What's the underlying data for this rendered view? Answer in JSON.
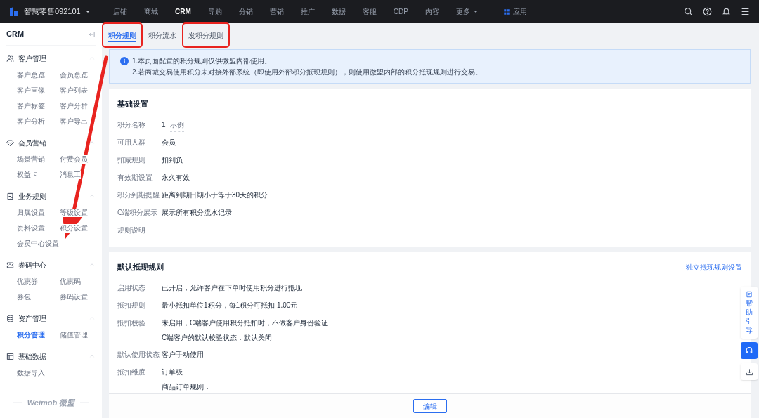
{
  "topbar": {
    "brand": "智慧零售092101",
    "nav": [
      {
        "label": "店铺",
        "selected": false,
        "kind": "link"
      },
      {
        "label": "商城",
        "selected": false,
        "kind": "link"
      },
      {
        "label": "CRM",
        "selected": true,
        "kind": "link"
      },
      {
        "label": "导购",
        "selected": false,
        "kind": "link"
      },
      {
        "label": "分销",
        "selected": false,
        "kind": "link"
      },
      {
        "label": "营销",
        "selected": false,
        "kind": "link"
      },
      {
        "label": "推广",
        "selected": false,
        "kind": "link"
      },
      {
        "label": "数据",
        "selected": false,
        "kind": "link"
      },
      {
        "label": "客服",
        "selected": false,
        "kind": "link"
      },
      {
        "label": "CDP",
        "selected": false,
        "kind": "link"
      },
      {
        "label": "内容",
        "selected": false,
        "kind": "link"
      },
      {
        "label": "更多",
        "selected": false,
        "kind": "dropdown"
      },
      {
        "label": "应用",
        "selected": false,
        "kind": "apps"
      }
    ]
  },
  "sidebar": {
    "title": "CRM",
    "groups": [
      {
        "label": "客户管理",
        "expanded": true,
        "items": [
          {
            "label": "客户总览",
            "selected": false
          },
          {
            "label": "会员总览",
            "selected": false
          },
          {
            "label": "客户画像",
            "selected": false
          },
          {
            "label": "客户列表",
            "selected": false
          },
          {
            "label": "客户标签",
            "selected": false
          },
          {
            "label": "客户分群",
            "selected": false
          },
          {
            "label": "客户分析",
            "selected": false
          },
          {
            "label": "客户导出",
            "selected": false
          }
        ]
      },
      {
        "label": "会员营销",
        "expanded": true,
        "items": [
          {
            "label": "场景营销",
            "selected": false
          },
          {
            "label": "付费会员",
            "selected": false
          },
          {
            "label": "权益卡",
            "selected": false
          },
          {
            "label": "消息工",
            "selected": false
          }
        ]
      },
      {
        "label": "业务规则",
        "expanded": true,
        "items": [
          {
            "label": "归属设置",
            "selected": false
          },
          {
            "label": "等级设置",
            "selected": false
          },
          {
            "label": "资料设置",
            "selected": false
          },
          {
            "label": "积分设置",
            "selected": false
          },
          {
            "label": "会员中心设置",
            "selected": false
          }
        ]
      },
      {
        "label": "券码中心",
        "expanded": true,
        "items": [
          {
            "label": "优惠券",
            "selected": false
          },
          {
            "label": "优惠码",
            "selected": false
          },
          {
            "label": "券包",
            "selected": false
          },
          {
            "label": "券码设置",
            "selected": false
          }
        ]
      },
      {
        "label": "资产管理",
        "expanded": true,
        "items": [
          {
            "label": "积分管理",
            "selected": true
          },
          {
            "label": "储值管理",
            "selected": false
          }
        ]
      },
      {
        "label": "基础数据",
        "expanded": true,
        "items": [
          {
            "label": "数据导入",
            "selected": false
          }
        ]
      }
    ],
    "footer": "Weimob 微盟"
  },
  "tabs": [
    {
      "label": "积分规则",
      "selected": true,
      "highlighted": true
    },
    {
      "label": "积分流水",
      "selected": false,
      "highlighted": false
    },
    {
      "label": "发积分规则",
      "selected": false,
      "highlighted": true
    }
  ],
  "notice": [
    "1.本页面配置的积分规则仅供微盟内部使用。",
    "2.若商城交易使用积分未对接外部系统（即使用外部积分抵现规则），则使用微盟内部的积分抵现规则进行交易。"
  ],
  "sections": [
    {
      "title": "基础设置",
      "fields": [
        {
          "label": "积分名称",
          "values": [
            "1"
          ],
          "link": "示例"
        },
        {
          "label": "可用人群",
          "values": [
            "会员"
          ]
        },
        {
          "label": "扣减规则",
          "values": [
            "扣到负"
          ]
        },
        {
          "label": "有效期设置",
          "values": [
            "永久有效"
          ]
        },
        {
          "label": "积分到期提醒",
          "values": [
            "距离到期日期小于等于30天的积分"
          ]
        },
        {
          "label": "C端积分展示",
          "values": [
            "展示所有积分流水记录"
          ]
        },
        {
          "label": "规则说明"
        }
      ]
    },
    {
      "title": "默认抵现规则",
      "action": "独立抵现规则设置",
      "fields": [
        {
          "label": "启用状态",
          "values": [
            "已开启，允许客户在下单时使用积分进行抵现"
          ]
        },
        {
          "label": "抵扣规则",
          "values": [
            "最小抵扣单位1积分，每1积分可抵扣 1.00元"
          ]
        },
        {
          "label": "抵扣校验",
          "values": [
            "未启用，C端客户使用积分抵扣时，不做客户身份验证",
            "C端客户的默认校验状态：默认关闭"
          ]
        },
        {
          "label": "默认使用状态",
          "values": [
            "客户手动使用"
          ]
        },
        {
          "label": "抵扣维度",
          "values": [
            "订单级",
            "商品订单规则："
          ]
        }
      ]
    }
  ],
  "edit_button": "编辑",
  "help": {
    "label": "帮助引导"
  },
  "annotation": {
    "arrow": true
  }
}
